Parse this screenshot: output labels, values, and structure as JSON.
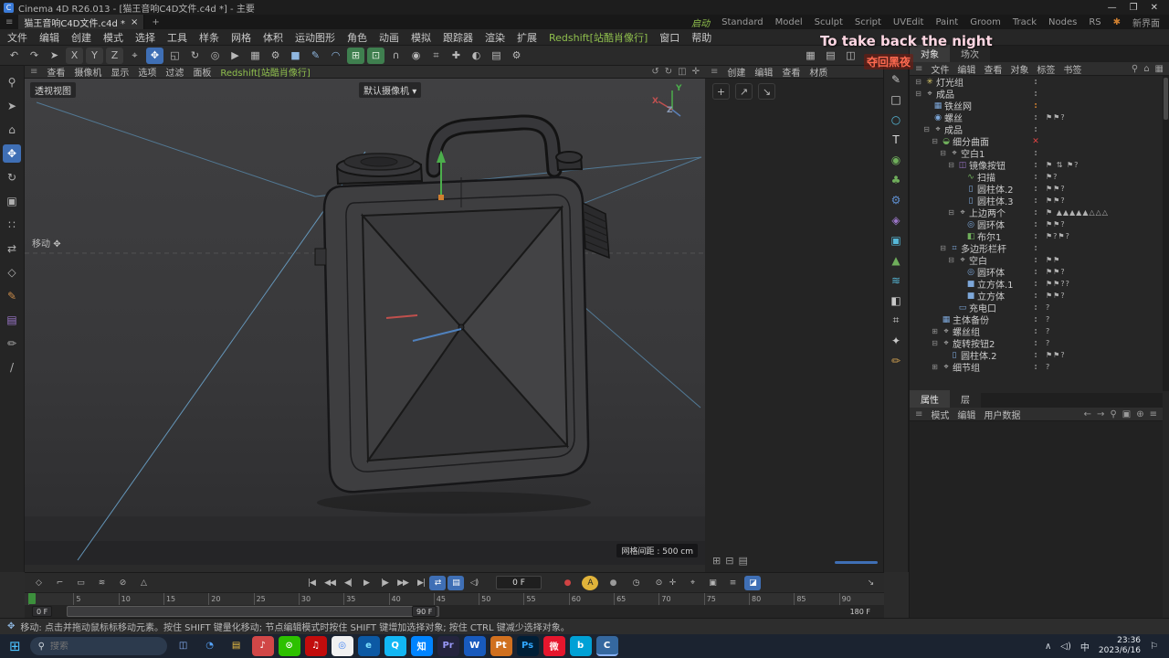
{
  "colors": {
    "accent": "#3f6fb5",
    "menu_green": "#8fbf4d",
    "snap_green": "#3f7f4f",
    "disabled_red": "#e04444"
  },
  "titlebar": {
    "app_initial": "C",
    "title": "Cinema 4D R26.013 - [猫王音响C4D文件.c4d *] - 主要",
    "minimize": "—",
    "maximize": "❐",
    "close": "✕"
  },
  "tabbar": {
    "menu_icon": "≡",
    "tab_label": "猫王音响C4D文件.c4d *",
    "tab_close": "×",
    "new_tab": "+",
    "startup": "启动",
    "layouts": [
      "Standard",
      "Model",
      "Sculpt",
      "Script",
      "UVEdit",
      "Paint",
      "Groom",
      "Track",
      "Nodes",
      "RS"
    ],
    "new_ui_dot": "✱",
    "new_ui": "新界面"
  },
  "menubar": {
    "items": [
      {
        "t": "文件"
      },
      {
        "t": "编辑"
      },
      {
        "t": "创建"
      },
      {
        "t": "模式"
      },
      {
        "t": "选择"
      },
      {
        "t": "工具"
      },
      {
        "t": "样条"
      },
      {
        "t": "网格"
      },
      {
        "t": "体积"
      },
      {
        "t": "运动图形"
      },
      {
        "t": "角色"
      },
      {
        "t": "动画"
      },
      {
        "t": "模拟"
      },
      {
        "t": "跟踪器"
      },
      {
        "t": "渲染"
      },
      {
        "t": "扩展"
      },
      {
        "t": "Redshift[站酷肖像行]",
        "c": "#8fbf4d"
      },
      {
        "t": "窗口"
      },
      {
        "t": "帮助"
      }
    ]
  },
  "toolbar": {
    "icons": [
      {
        "g": "↶",
        "n": "undo-icon"
      },
      {
        "g": "↷",
        "n": "redo-icon"
      },
      {
        "g": "➤",
        "n": "live-selection-icon"
      },
      {
        "g": "X",
        "bg": "#3a3a3a",
        "n": "lock-x-button"
      },
      {
        "g": "Y",
        "bg": "#3a3a3a",
        "n": "lock-y-button"
      },
      {
        "g": "Z",
        "bg": "#3a3a3a",
        "n": "lock-z-button"
      },
      {
        "g": "⌖",
        "n": "coord-system-icon"
      },
      {
        "g": "✥",
        "bg": "#3f6fb5",
        "c": "#ffffff",
        "n": "move-tool-icon"
      },
      {
        "g": "◱",
        "n": "scale-tool-icon"
      },
      {
        "g": "↻",
        "n": "rotate-tool-icon"
      },
      {
        "g": "◎",
        "n": "last-tool-icon"
      },
      {
        "g": "▶",
        "n": "render-view-icon"
      },
      {
        "g": "▦",
        "n": "render-picture-icon"
      },
      {
        "g": "⚙",
        "n": "render-settings-icon"
      },
      {
        "g": "■",
        "c": "#8fb7e0",
        "n": "add-cube-icon"
      },
      {
        "g": "✎",
        "c": "#8fb7e0",
        "n": "add-spline-icon"
      },
      {
        "g": "◠",
        "c": "#8fb7e0",
        "n": "add-generator-icon"
      },
      {
        "g": "⊞",
        "bg": "#3f7f4f",
        "c": "#d8ead8",
        "n": "snap-grid-icon"
      },
      {
        "g": "⊡",
        "bg": "#3f7f4f",
        "c": "#d8ead8",
        "n": "quantize-icon"
      },
      {
        "g": "∩",
        "n": "magnet-icon"
      },
      {
        "g": "◉",
        "n": "snap-3d-icon"
      },
      {
        "g": "⌗",
        "n": "workplane-icon"
      },
      {
        "g": "✚",
        "n": "axis-icon"
      },
      {
        "g": "◐",
        "n": "isolate-icon"
      },
      {
        "g": "▤",
        "n": "manager-icon"
      },
      {
        "g": "⚙",
        "n": "options-icon"
      }
    ],
    "right_icons": [
      {
        "g": "▦",
        "n": "capture-icon"
      },
      {
        "g": "▤",
        "n": "layout-icon"
      },
      {
        "g": "◫",
        "n": "panel-icon"
      }
    ]
  },
  "left_toolbar": {
    "icons": [
      {
        "g": "⚲",
        "n": "zoom-icon"
      },
      {
        "g": "➤",
        "n": "select-icon"
      },
      {
        "g": "⌂",
        "n": "make-editable-icon"
      },
      {
        "g": "✥",
        "bg": "#3f6fb5",
        "c": "#ffffff",
        "n": "model-mode-icon"
      },
      {
        "g": "↻",
        "n": "texture-mode-icon"
      },
      {
        "g": "▣",
        "n": "workplane-mode-icon"
      },
      {
        "g": "∷",
        "n": "points-mode-icon"
      },
      {
        "g": "⇄",
        "n": "edges-mode-icon"
      },
      {
        "g": "◇",
        "n": "polygons-mode-icon"
      },
      {
        "g": "✎",
        "c": "#c98b4a",
        "n": "tweak-mode-icon"
      },
      {
        "g": "▤",
        "c": "#9b76c9",
        "n": "axis-mode-icon"
      },
      {
        "g": "✏",
        "n": "solo-icon"
      },
      {
        "g": "/",
        "n": "snap-toggle-icon"
      }
    ]
  },
  "viewport": {
    "menus": [
      {
        "t": "查看"
      },
      {
        "t": "摄像机"
      },
      {
        "t": "显示"
      },
      {
        "t": "选项"
      },
      {
        "t": "过滤"
      },
      {
        "t": "面板"
      },
      {
        "t": "Redshift[站酷肖像行]",
        "c": "#8fbf4d"
      }
    ],
    "menu_icon": "≡",
    "corner_icons": [
      "↺",
      "↻",
      "◫",
      "✛"
    ],
    "view_label": "透视视图",
    "camera_label": "默认摄像机",
    "camera_dropdown": "▾",
    "tool_label": "移动",
    "tool_icon": "✥",
    "grid_label": "网格间距 : 500 cm",
    "axis": {
      "x": "X",
      "y": "Y",
      "z": "Z"
    }
  },
  "material_panel": {
    "menu_icon": "≡",
    "menus": [
      "创建",
      "编辑",
      "查看",
      "材质"
    ],
    "tool_icons": [
      "+",
      "↗",
      "↘"
    ],
    "bottom_icons": [
      "⊞",
      "⊟",
      "▤"
    ]
  },
  "shelf": {
    "icons": [
      {
        "g": "✎",
        "c": "#c8c8c8"
      },
      {
        "g": "□",
        "c": "#d8d8d8"
      },
      {
        "g": "○",
        "c": "#56b8d8"
      },
      {
        "g": "T",
        "c": "#d8d8d8"
      },
      {
        "g": "◉",
        "c": "#6fae5b"
      },
      {
        "g": "♣",
        "c": "#6fae5b"
      },
      {
        "g": "⚙",
        "c": "#5f8fd0"
      },
      {
        "g": "◈",
        "c": "#9b76c9"
      },
      {
        "g": "▣",
        "c": "#56b8d8"
      },
      {
        "g": "▲",
        "c": "#6fae5b"
      },
      {
        "g": "≋",
        "c": "#56b8d8"
      },
      {
        "g": "◧",
        "c": "#c8c8c8"
      },
      {
        "g": "⌗",
        "c": "#c8c8c8"
      },
      {
        "g": "✦",
        "c": "#c8c8c8"
      },
      {
        "g": "✏",
        "c": "#d0a050"
      }
    ]
  },
  "object_panel": {
    "tabs": [
      {
        "label": "对象",
        "active": true
      },
      {
        "label": "场次"
      }
    ],
    "menu_icon": "≡",
    "menus": [
      "文件",
      "编辑",
      "查看",
      "对象",
      "标签",
      "书签"
    ],
    "header_icons": [
      "⚲",
      "⌂",
      "▦"
    ],
    "tree": [
      {
        "lvl": 0,
        "exp": "⊟",
        "icon": "✳",
        "ic": "#d9c96a",
        "label": "灯光组",
        "marks": ":",
        "tags": ""
      },
      {
        "lvl": 0,
        "exp": "⊟",
        "icon": "⌖",
        "ic": "#c0c0c0",
        "label": "成品",
        "marks": ":",
        "tags": ""
      },
      {
        "lvl": 1,
        "exp": "",
        "icon": "▦",
        "ic": "#7da7d9",
        "label": "铁丝网",
        "marks": ":",
        "mc": "#d08030",
        "tags": ""
      },
      {
        "lvl": 1,
        "exp": "",
        "icon": "◉",
        "ic": "#7da7d9",
        "label": "螺丝",
        "marks": ":",
        "tags": "⚑⚑?"
      },
      {
        "lvl": 1,
        "exp": "⊟",
        "icon": "⌖",
        "ic": "#c0c0c0",
        "label": "成品",
        "marks": ":",
        "tags": ""
      },
      {
        "lvl": 2,
        "exp": "⊟",
        "icon": "◒",
        "ic": "#6fae5b",
        "label": "细分曲面",
        "marks": "✕",
        "mc": "#e04444",
        "tags": ""
      },
      {
        "lvl": 3,
        "exp": "⊟",
        "icon": "⌖",
        "ic": "#c0c0c0",
        "label": "空白1",
        "marks": ":",
        "tags": ""
      },
      {
        "lvl": 4,
        "exp": "⊟",
        "icon": "◫",
        "ic": "#9b76c9",
        "label": "镜像按钮",
        "marks": ":",
        "tags": "⚑ ⇅ ⚑?"
      },
      {
        "lvl": 5,
        "exp": "",
        "icon": "∿",
        "ic": "#6fae5b",
        "label": "扫描",
        "marks": ":",
        "tags": "⚑?"
      },
      {
        "lvl": 5,
        "exp": "",
        "icon": "▯",
        "ic": "#7da7d9",
        "label": "圆柱体.2",
        "marks": ":",
        "tags": "⚑⚑?"
      },
      {
        "lvl": 5,
        "exp": "",
        "icon": "▯",
        "ic": "#7da7d9",
        "label": "圆柱体.3",
        "marks": ":",
        "tags": "⚑⚑?"
      },
      {
        "lvl": 4,
        "exp": "⊟",
        "icon": "⌖",
        "ic": "#c0c0c0",
        "label": "上边两个",
        "marks": ":",
        "tags": "⚑ ▲▲▲▲▲△△△"
      },
      {
        "lvl": 5,
        "exp": "",
        "icon": "◎",
        "ic": "#7da7d9",
        "label": "圆环体",
        "marks": ":",
        "tags": "⚑⚑?"
      },
      {
        "lvl": 5,
        "exp": "",
        "icon": "◧",
        "ic": "#6fae5b",
        "label": "布尔1",
        "marks": ":",
        "tags": "⚑?⚑?"
      },
      {
        "lvl": 3,
        "exp": "⊟",
        "icon": "⌗",
        "ic": "#7da7d9",
        "label": "多边形栏杆",
        "marks": ":",
        "tags": ""
      },
      {
        "lvl": 4,
        "exp": "⊟",
        "icon": "⌖",
        "ic": "#c0c0c0",
        "label": "空白",
        "marks": ":",
        "tags": "⚑⚑"
      },
      {
        "lvl": 5,
        "exp": "",
        "icon": "◎",
        "ic": "#7da7d9",
        "label": "圆环体",
        "marks": ":",
        "tags": "⚑⚑?"
      },
      {
        "lvl": 5,
        "exp": "",
        "icon": "■",
        "ic": "#7da7d9",
        "label": "立方体.1",
        "marks": ":",
        "tags": "⚑⚑??"
      },
      {
        "lvl": 5,
        "exp": "",
        "icon": "■",
        "ic": "#7da7d9",
        "label": "立方体",
        "marks": ":",
        "tags": "⚑⚑?"
      },
      {
        "lvl": 4,
        "exp": "",
        "icon": "▭",
        "ic": "#7da7d9",
        "label": "充电口",
        "marks": ":",
        "tags": "?"
      },
      {
        "lvl": 2,
        "exp": "",
        "icon": "▦",
        "ic": "#7da7d9",
        "label": "主体备份",
        "marks": ":",
        "tags": "?"
      },
      {
        "lvl": 2,
        "exp": "⊞",
        "icon": "⌖",
        "ic": "#c0c0c0",
        "label": "螺丝组",
        "marks": ":",
        "tags": "?"
      },
      {
        "lvl": 2,
        "exp": "⊟",
        "icon": "⌖",
        "ic": "#c0c0c0",
        "label": "旋转按钮2",
        "marks": ":",
        "tags": "?"
      },
      {
        "lvl": 3,
        "exp": "",
        "icon": "▯",
        "ic": "#7da7d9",
        "label": "圆柱体.2",
        "marks": ":",
        "tags": "⚑⚑?"
      },
      {
        "lvl": 2,
        "exp": "⊞",
        "icon": "⌖",
        "ic": "#c0c0c0",
        "label": "细节组",
        "marks": ":",
        "tags": "?"
      }
    ]
  },
  "attr_panel": {
    "tabs": [
      {
        "label": "属性",
        "active": true
      },
      {
        "label": "层"
      }
    ],
    "menu_icon": "≡",
    "menus": [
      "模式",
      "编辑",
      "用户数据"
    ],
    "nav_icons": [
      "←",
      "→",
      "⚲",
      "▣",
      "⊕",
      "≡"
    ]
  },
  "anim": {
    "left_icons": [
      {
        "g": "◇",
        "n": "keyframe-icon"
      },
      {
        "g": "⌐",
        "n": "marker-icon"
      },
      {
        "g": "▭",
        "n": "region-icon"
      },
      {
        "g": "≋",
        "n": "motion-icon"
      },
      {
        "g": "⊘",
        "n": "mute-icon"
      },
      {
        "g": "△",
        "n": "warning-icon"
      }
    ],
    "transport": [
      {
        "g": "|◀",
        "n": "goto-start-button"
      },
      {
        "g": "◀◀",
        "n": "prev-key-button"
      },
      {
        "g": "◀|",
        "n": "prev-frame-button"
      },
      {
        "g": "▶",
        "n": "play-button"
      },
      {
        "g": "|▶",
        "n": "next-frame-button"
      },
      {
        "g": "▶▶",
        "n": "next-key-button"
      },
      {
        "g": "▶|",
        "n": "goto-end-button"
      }
    ],
    "toggles": [
      {
        "g": "⇄",
        "bg": "#3f6fb5",
        "c": "#ffffff",
        "n": "loop-toggle"
      },
      {
        "g": "▤",
        "bg": "#3f6fb5",
        "c": "#ffffff",
        "n": "range-toggle"
      },
      {
        "g": "◁)",
        "n": "sound-toggle"
      }
    ],
    "frame_field": "0 F",
    "record_icons": [
      {
        "g": "●",
        "c": "#d04343",
        "n": "record-button"
      },
      {
        "g": "A",
        "bg": "#e0b33a",
        "c": "#222222",
        "br": "50%",
        "n": "autokey-button"
      },
      {
        "g": "●",
        "c": "#9a9a9a",
        "n": "key-selection-button"
      },
      {
        "g": "◷",
        "c": "#c0c0c0",
        "n": "time-button"
      },
      {
        "g": "⊙",
        "c": "#c0c0c0",
        "n": "keyframe-mode-button"
      }
    ],
    "snap_icons": [
      {
        "g": "✛",
        "n": "record-position-button"
      },
      {
        "g": "⌖",
        "n": "record-scale-button"
      },
      {
        "g": "▣",
        "n": "record-rotation-button"
      },
      {
        "g": "≡",
        "n": "record-param-button"
      },
      {
        "g": "◪",
        "bg": "#3f6fb5",
        "c": "#ffffff",
        "n": "record-pla-button"
      }
    ],
    "corner_icon": "↘"
  },
  "timeline": {
    "ticks": [
      "0",
      "5",
      "10",
      "15",
      "20",
      "25",
      "30",
      "35",
      "40",
      "45",
      "50",
      "55",
      "60",
      "65",
      "70",
      "75",
      "80",
      "85",
      "90"
    ],
    "range_start": "0 F",
    "range_end": "90 F",
    "total": "180 F"
  },
  "statusbar": {
    "icon": "✥",
    "text": "移动: 点击并拖动鼠标标移动元素。按住 SHIFT 键量化移动; 节点编辑模式时按住 SHIFT 键增加选择对象; 按住 CTRL 键减少选择对象。"
  },
  "subtitles": {
    "en": "To take back the night",
    "zh": "夺回黑夜"
  },
  "taskbar": {
    "win_icon": "⊞",
    "search_placeholder": "搜索",
    "search_icon": "⚲",
    "apps": [
      {
        "g": "◫",
        "c": "#8ab4f8",
        "n": "task-view-icon"
      },
      {
        "g": "◔",
        "c": "#58a6ff",
        "n": "widgets-icon"
      },
      {
        "g": "▤",
        "c": "#f0c244",
        "n": "file-explorer-icon"
      },
      {
        "g": "♪",
        "bg": "#d14747",
        "c": "#ffffff",
        "n": "music-app-icon"
      },
      {
        "g": "⊙",
        "bg": "#2dc100",
        "c": "#ffffff",
        "n": "wechat-icon"
      },
      {
        "g": "♫",
        "bg": "#c20c0c",
        "c": "#ffffff",
        "n": "netease-music-icon"
      },
      {
        "g": "◎",
        "bg": "#f1f1f1",
        "c": "#4285f4",
        "n": "chrome-icon"
      },
      {
        "g": "e",
        "bg": "#0c59a4",
        "c": "#7ce0ff",
        "n": "edge-icon"
      },
      {
        "g": "Q",
        "bg": "#12b7f5",
        "c": "#ffffff",
        "n": "qq-icon"
      },
      {
        "g": "知",
        "bg": "#0084ff",
        "c": "#ffffff",
        "n": "zhihu-icon"
      },
      {
        "g": "Pr",
        "bg": "#24243e",
        "c": "#9999f8",
        "n": "premiere-icon"
      },
      {
        "g": "W",
        "bg": "#185abd",
        "c": "#ffffff",
        "n": "word-icon"
      },
      {
        "g": "Pt",
        "bg": "#d0701f",
        "c": "#ffffff",
        "n": "pt-app-icon"
      },
      {
        "g": "Ps",
        "bg": "#001e36",
        "c": "#31a8ff",
        "n": "photoshop-icon"
      },
      {
        "g": "微",
        "bg": "#e6162d",
        "c": "#ffe9e9",
        "n": "weibo-icon"
      },
      {
        "g": "b",
        "bg": "#00a1d6",
        "c": "#ffffff",
        "n": "bilibili-icon"
      },
      {
        "g": "C",
        "bg": "#35689f",
        "c": "#ffffff",
        "ul": "#8ab4f8",
        "n": "cinema4d-icon"
      }
    ],
    "tray": {
      "chevron": "∧",
      "speaker": "◁)",
      "lang": "中",
      "time": "23:36",
      "date": "2023/6/16",
      "bell": "⚐"
    }
  }
}
